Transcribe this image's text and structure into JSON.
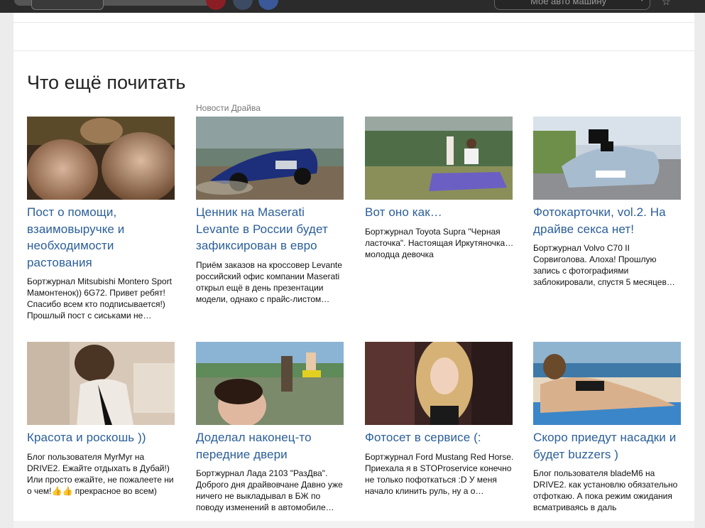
{
  "topbar": {
    "car_select_label": "Моё авто машину",
    "icons": [
      "search-icon",
      "social-icon",
      "social-icon",
      "facebook-icon",
      "chevron-down-icon",
      "bookmark-icon"
    ]
  },
  "section": {
    "heading": "Что ещё почитать"
  },
  "cards": [
    {
      "category": "",
      "title": "Пост о помощи, взаимовыручке и необходимости растования",
      "desc": "Бортжурнал Mitsubishi Montero Sport Мамонтенок)) 6G72. Привет ребят! Спасибо всем кто подписывается!) Прошлый пост с сиськами не…"
    },
    {
      "category": "Новости Драйва",
      "title": "Ценник на Maserati Levante в России будет зафиксирован в евро",
      "desc": "Приём заказов на кроссовер Levante российский офис компании Maserati открыл ещё в день презентации модели, однако с прайс-листом…"
    },
    {
      "category": "",
      "title": "Вот оно как…",
      "desc": "Бортжурнал Toyota Supra \"Черная ласточка\". Настоящая Иркутяночка…молодца девочка"
    },
    {
      "category": "",
      "title": "Фотокарточки, vol.2. На драйве секса нет!",
      "desc": "Бортжурнал Volvo C70 II Сорвиголова. Алоха! Прошлую запись с фотографиями заблокировали, спустя 5 месяцев…"
    },
    {
      "category": "",
      "title": "Красота и роскошь ))",
      "desc": "Блог пользователя MyrMyr на DRIVE2. Ежайте отдыхать в Дубай!) Или просто ежайте, не пожалеете ни о чем!👍👍 прекрасное во всем)"
    },
    {
      "category": "",
      "title": "Доделал наконец-то передние двери",
      "desc": "Бортжурнал Лада 2103 \"РазДва\". Доброго дня драйвовчане Давно уже ничего не выкладывал в БЖ по поводу изменений в автомобиле…"
    },
    {
      "category": "",
      "title": "Фотосет в сервисе (:",
      "desc": "Бортжурнал Ford Mustang Red Horse. Приехала я в STOProservice конечно не только пофоткаться :D У меня начало клинить руль, ну а о…"
    },
    {
      "category": "",
      "title": "Скоро приедут насадки и будет buzzers )",
      "desc": "Блог пользователя bladeM6 на DRIVE2. как установлю обязательно отфоткаю. А пока режим ожидания всматриваясь в даль"
    }
  ],
  "colors": {
    "link": "#2a5e9a",
    "topbar": "#2b2b2b",
    "background": "#ececec"
  }
}
